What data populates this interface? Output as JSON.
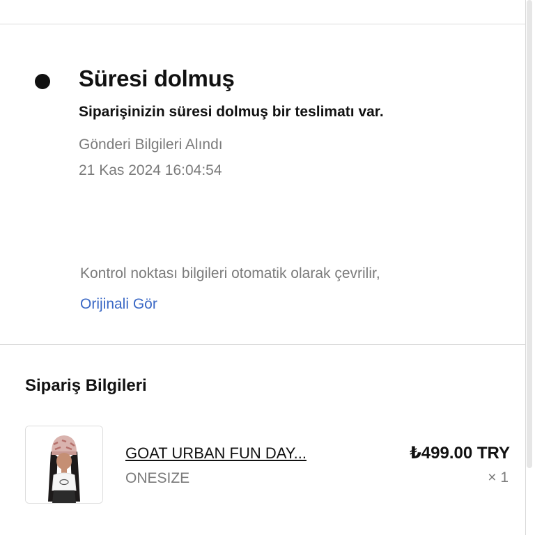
{
  "status": {
    "title": "Süresi dolmuş",
    "description": "Siparişinizin süresi dolmuş bir teslimatı var.",
    "event_label": "Gönderi Bilgileri Alındı",
    "event_time": "21 Kas 2024 16:04:54"
  },
  "translation": {
    "note": "Kontrol noktası bilgileri otomatik olarak çevrilir,",
    "show_original_link": "Orijinali Gör"
  },
  "order": {
    "section_title": "Sipariş Bilgileri",
    "item": {
      "name": "GOAT URBAN FUN DAY...",
      "variant": "ONESIZE",
      "price": "₺499.00 TRY",
      "quantity": "× 1",
      "image_icon": "product-photo-icon"
    }
  },
  "colors": {
    "link": "#3a68c5",
    "muted_text": "#7b7b7b",
    "divider": "#dcdcdc"
  }
}
